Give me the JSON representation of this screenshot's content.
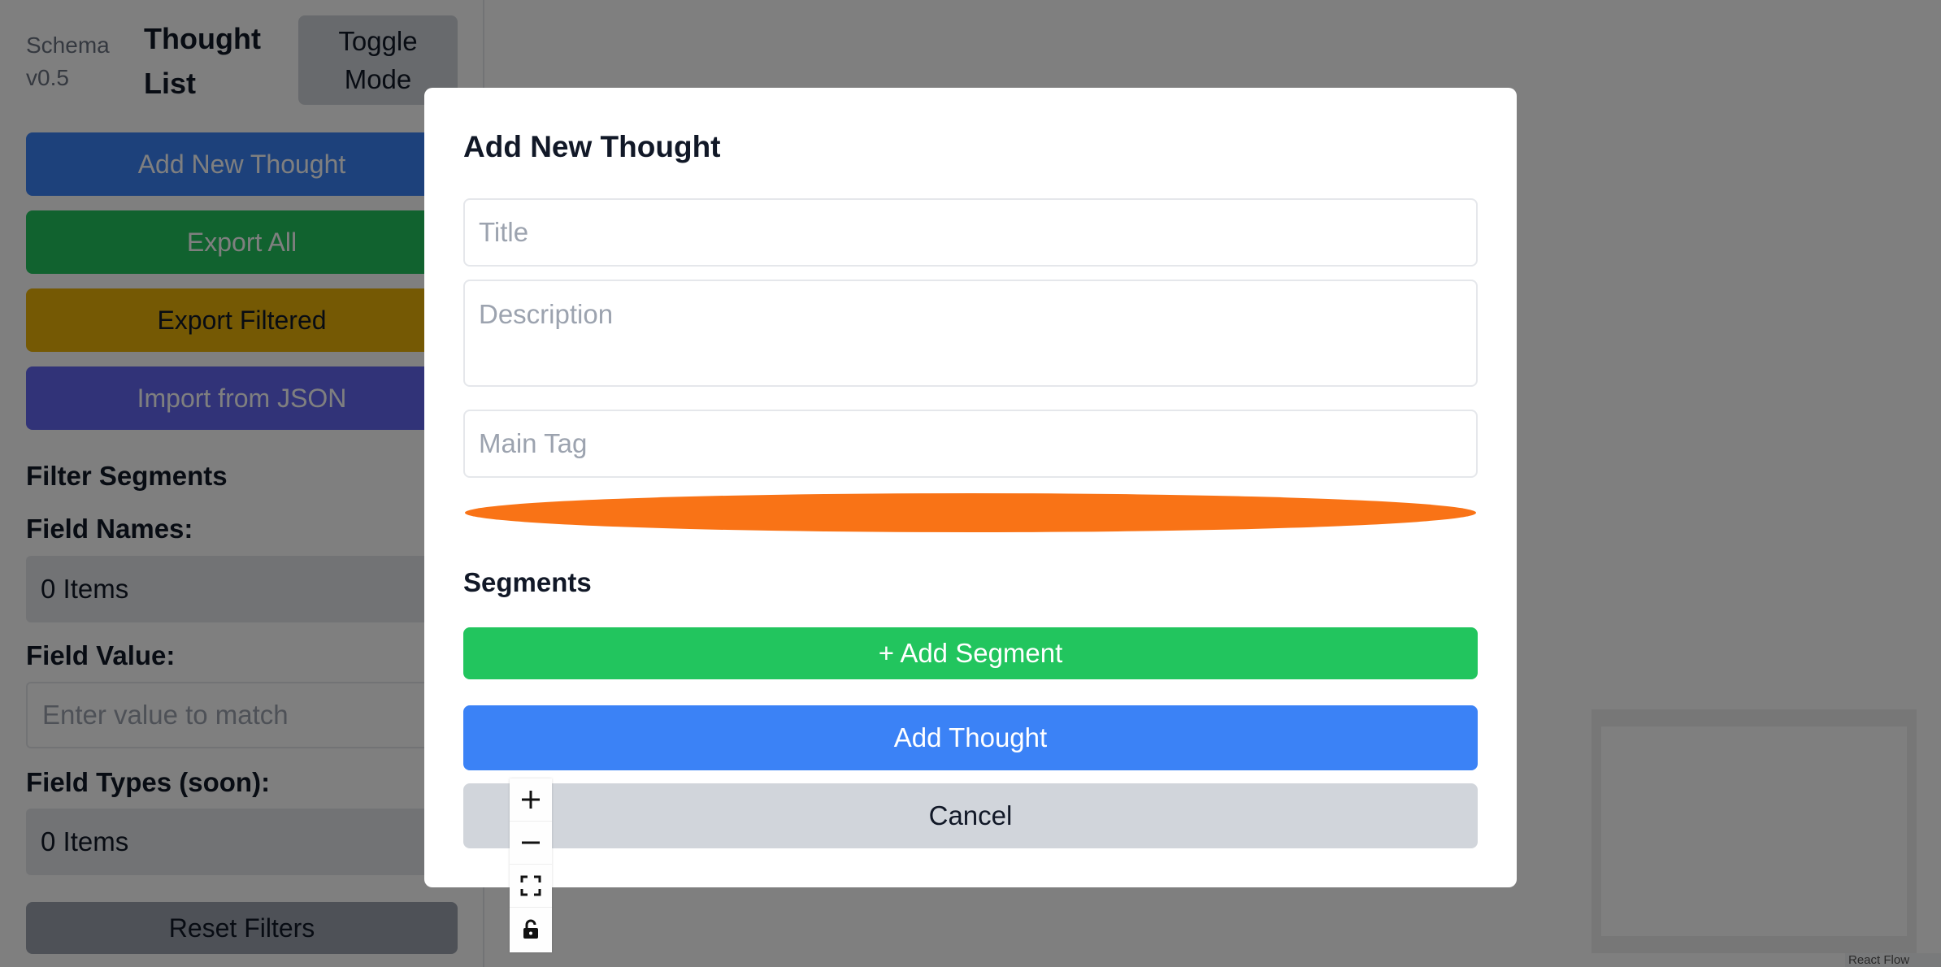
{
  "sidebar": {
    "schema_line1": "Schema",
    "schema_line2": "v0.5",
    "title_line1": "Thought",
    "title_line2": "List",
    "toggle_line1": "Toggle",
    "toggle_line2": "Mode",
    "buttons": {
      "add_new": "Add New Thought",
      "export_all": "Export All",
      "export_filtered": "Export Filtered",
      "import_json": "Import from JSON"
    },
    "filter": {
      "heading": "Filter Segments",
      "field_names_label": "Field Names:",
      "field_names_value": "0 Items",
      "field_value_label": "Field Value:",
      "field_value_placeholder": "Enter value to match",
      "field_types_label": "Field Types (soon):",
      "field_types_value": "0 Items",
      "reset_label": "Reset Filters"
    }
  },
  "modal": {
    "title": "Add New Thought",
    "title_placeholder": "Title",
    "description_placeholder": "Description",
    "main_tag_placeholder": "Main Tag",
    "selected_color": "#f97316",
    "segments_heading": "Segments",
    "add_segment_label": "+ Add Segment",
    "submit_label": "Add Thought",
    "cancel_label": "Cancel"
  },
  "canvas_controls": [
    "zoom-in-icon",
    "zoom-out-icon",
    "fit-view-icon",
    "lock-icon"
  ],
  "attribution": "React Flow",
  "colors": {
    "primary": "#3b82f6",
    "success": "#22c55e",
    "warning": "#eab308",
    "indigo": "#6366f1",
    "accent_orange": "#f97316",
    "overlay": "rgba(0,0,0,0.5)"
  }
}
